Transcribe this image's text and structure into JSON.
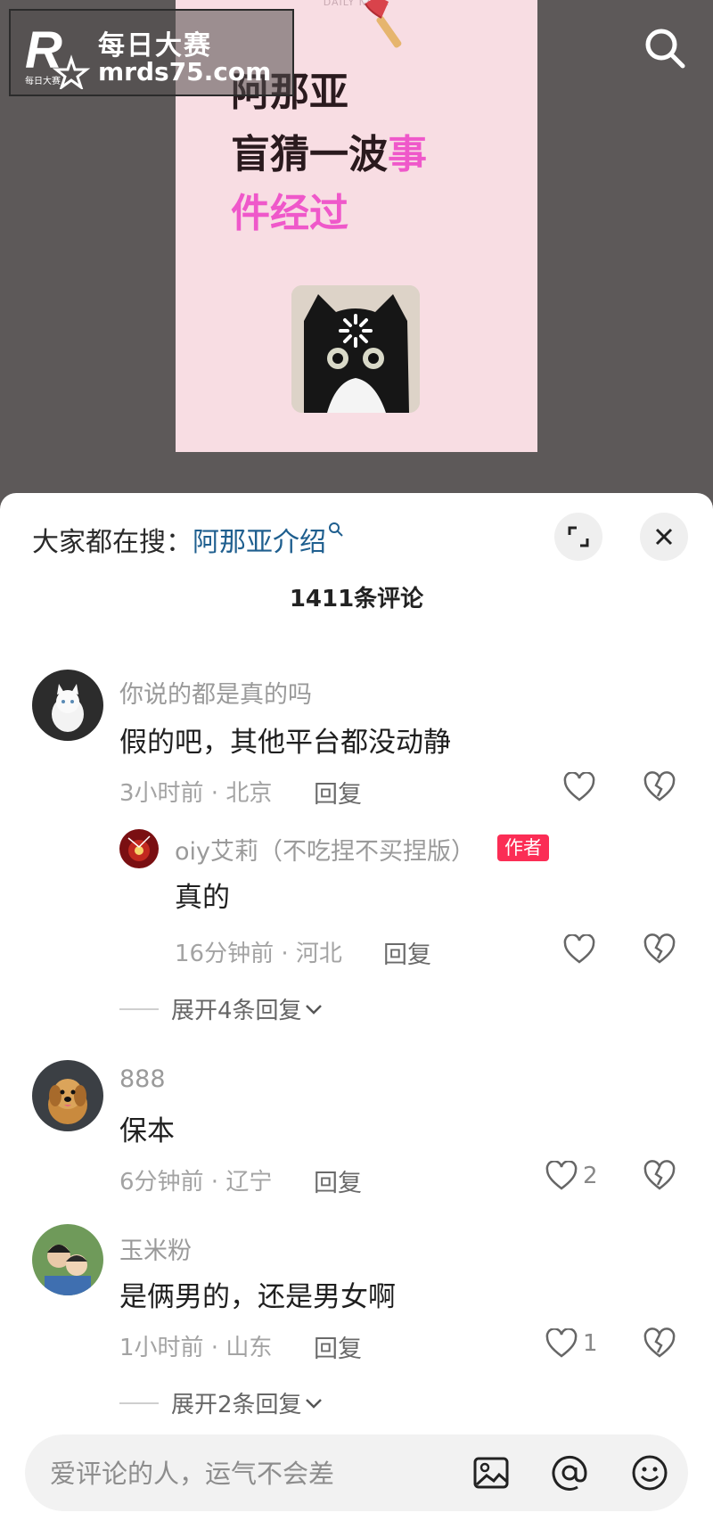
{
  "watermark": {
    "cn": "每日大赛",
    "url": "mrds75.com",
    "logo_small": "每日大赛"
  },
  "note": {
    "header": "DAILY NOTE",
    "line1": "阿那亚",
    "line2_a": "盲猜一波",
    "line2_b": "事",
    "line3": "件经过",
    "accent": "#ef58ca"
  },
  "comments_panel": {
    "hot_search_label": "大家都在搜：",
    "hot_search_term": "阿那亚介绍",
    "count_label": "1411条评论",
    "comments": [
      {
        "username": "你说的都是真的吗",
        "text": "假的吧，其他平台都没动静",
        "meta": "3小时前 · 北京",
        "reply_label": "回复",
        "likes": "",
        "replies": [
          {
            "username": "oiy艾莉（不吃捏不买捏版）",
            "badge": "作者",
            "text": "真的",
            "meta": "16分钟前 · 河北",
            "reply_label": "回复",
            "likes": ""
          }
        ],
        "expand_label": "展开4条回复"
      },
      {
        "username": "888",
        "text": "保本",
        "meta": "6分钟前 · 辽宁",
        "reply_label": "回复",
        "likes": "2"
      },
      {
        "username": "玉米粉",
        "text": "是俩男的，还是男女啊",
        "meta": "1小时前 · 山东",
        "reply_label": "回复",
        "likes": "1",
        "expand_label": "展开2条回复"
      }
    ]
  },
  "input": {
    "placeholder": "爱评论的人，运气不会差"
  },
  "icons": [
    "search-icon",
    "expand-icon",
    "close-icon",
    "heart-icon",
    "dislike-heart-icon",
    "image-icon",
    "at-icon",
    "emoji-icon",
    "chevron-down-icon"
  ],
  "colors": {
    "author_badge": "#fb2d55",
    "hot_term": "#1f5f8f"
  }
}
